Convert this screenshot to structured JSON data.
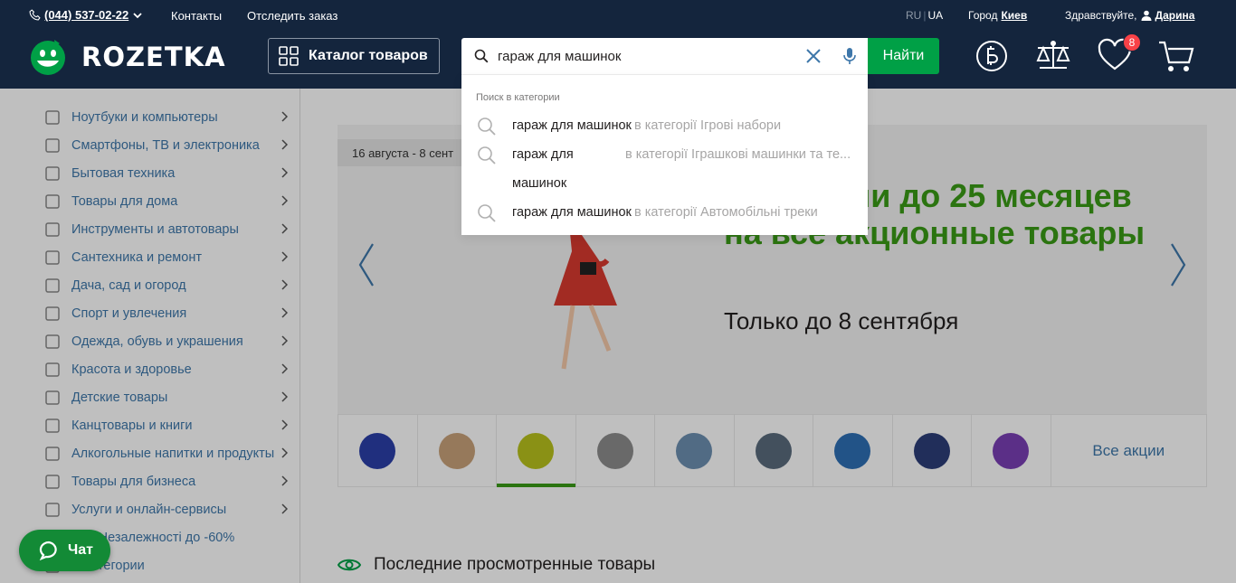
{
  "topbar": {
    "phone": "(044) 537-02-22",
    "contacts": "Контакты",
    "track_order": "Отследить заказ",
    "lang_ru": "RU",
    "lang_ua": "UA",
    "city_label": "Город",
    "city_value": "Киев",
    "greeting": "Здравствуйте,",
    "user_name": "Дарина"
  },
  "header": {
    "logo_text": "ROZETKA",
    "catalog_label": "Каталог товаров",
    "search_value": "гараж для машинок",
    "search_button": "Найти",
    "wishlist_count": "8"
  },
  "suggestions": {
    "caption": "Поиск в категории",
    "items": [
      {
        "query": "гараж для машинок",
        "category": "в категорії Ігрові набори"
      },
      {
        "query": "гараж для",
        "query_line2": "машинок",
        "category": "в категорії Іграшкові машинки та те..."
      },
      {
        "query": "гараж для машинок",
        "category": "в категорії Автомобільні треки"
      }
    ]
  },
  "sidebar": {
    "items": [
      {
        "label": "Ноутбуки и компьютеры",
        "icon": "laptop-icon"
      },
      {
        "label": "Смартфоны, ТВ и электроника",
        "icon": "smartphone-icon"
      },
      {
        "label": "Бытовая техника",
        "icon": "washer-icon"
      },
      {
        "label": "Товары для дома",
        "icon": "chair-icon"
      },
      {
        "label": "Инструменты и автотовары",
        "icon": "tools-icon"
      },
      {
        "label": "Сантехника и ремонт",
        "icon": "bathtub-icon"
      },
      {
        "label": "Дача, сад и огород",
        "icon": "garden-icon"
      },
      {
        "label": "Спорт и увлечения",
        "icon": "sport-icon"
      },
      {
        "label": "Одежда, обувь и украшения",
        "icon": "tshirt-icon"
      },
      {
        "label": "Красота и здоровье",
        "icon": "beauty-icon"
      },
      {
        "label": "Детские товары",
        "icon": "bear-icon"
      },
      {
        "label": "Канцтовары и книги",
        "icon": "paperclip-icon"
      },
      {
        "label": "Алкогольные напитки и продукты",
        "icon": "glass-icon"
      },
      {
        "label": "Товары для бизнеса",
        "icon": "barcode-icon"
      },
      {
        "label": "Услуги и онлайн-сервисы",
        "icon": "services-icon"
      },
      {
        "label": "…ія Незалежності до -60%",
        "icon": "sale-icon"
      },
      {
        "label": "…категории",
        "icon": "more-icon"
      }
    ]
  },
  "banner": {
    "date": "16 августа - 8 сент",
    "headline": "…частями до 25 месяцев на все акционные товары",
    "subline": "Только до 8 сентября"
  },
  "promo_thumbs": {
    "all_label": "Все акции",
    "colors": [
      "#2b3fa8",
      "#c9a27a",
      "#b8c21c",
      "#8d8d8d",
      "#6c8fb0",
      "#5a6b7c",
      "#2e6fb5",
      "#2d3e78",
      "#7a3fb5"
    ]
  },
  "recent": {
    "title": "Последние просмотренные товары"
  },
  "chat": {
    "label": "Чат"
  },
  "colors": {
    "header_bg": "#14253d",
    "accent_green": "#00a046",
    "link_blue": "#3e77aa",
    "badge_red": "#f84147"
  }
}
